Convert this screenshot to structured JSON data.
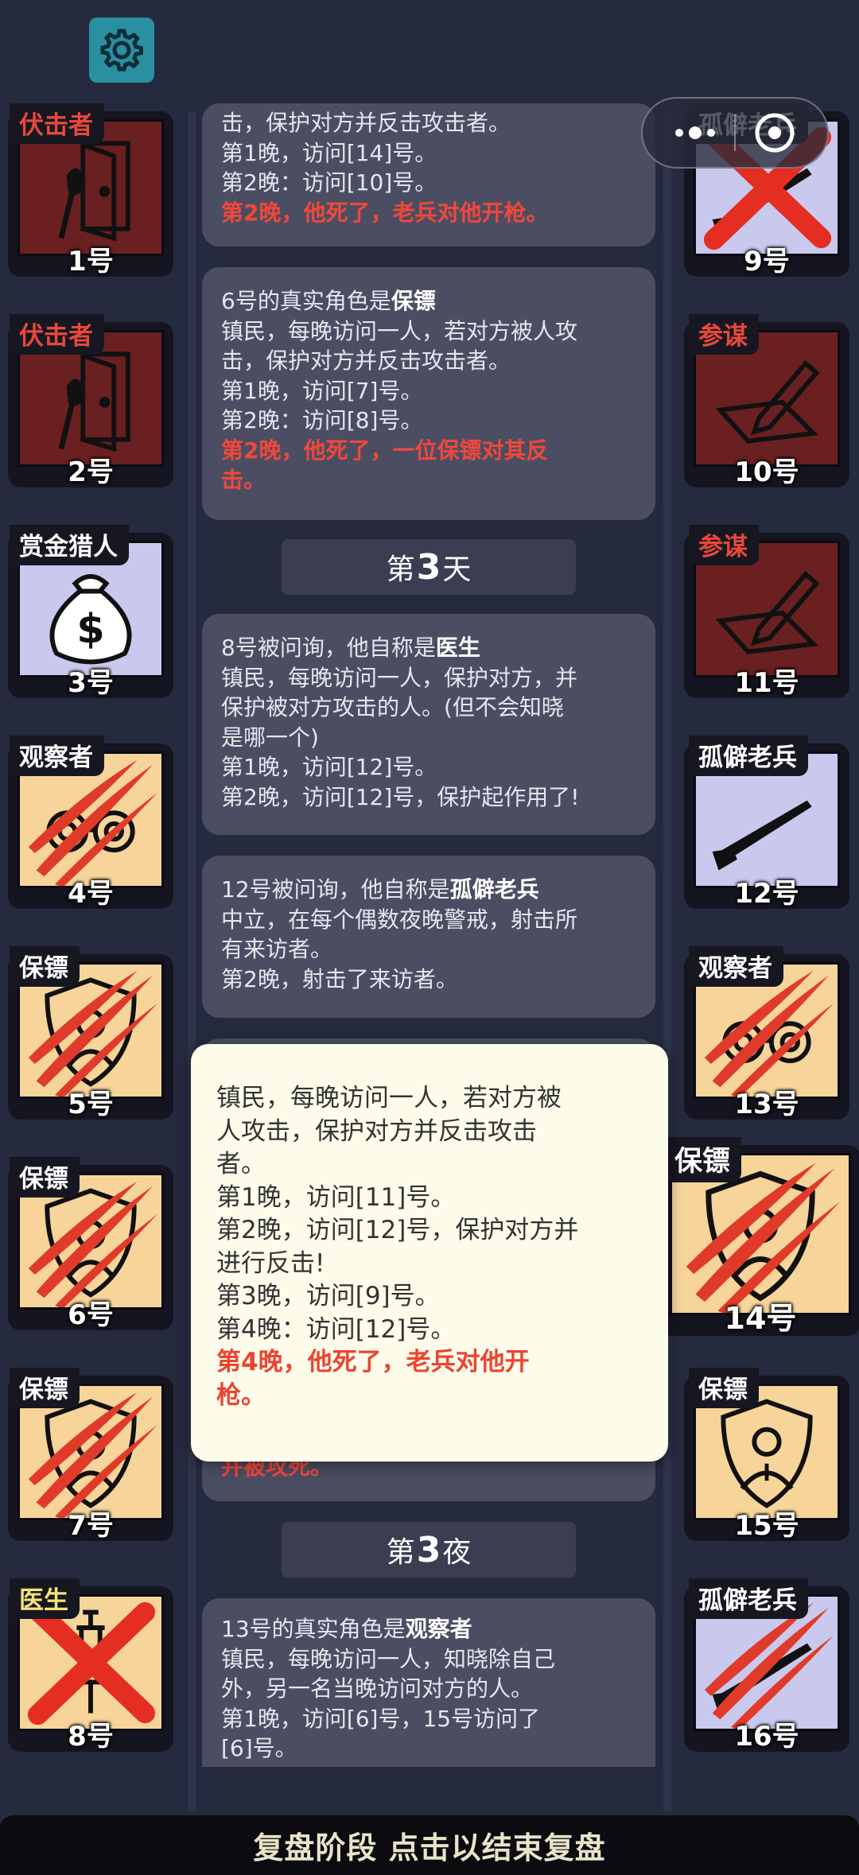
{
  "colors": {
    "background": "#262a3f",
    "log_entry_bg": "#4b4e63",
    "death_text": "#f2473a",
    "role_red": "#e8483a",
    "role_white": "#ffffff",
    "role_gold": "#f6e27a",
    "popup_bg": "#fdfbea",
    "settings_bg": "#2a8fa0"
  },
  "settings": {
    "icon": "gear-icon"
  },
  "mini_program": {
    "more_icon": "more-dots-icon",
    "close_icon": "target-circle-icon"
  },
  "left_players": [
    {
      "role": "伏击者",
      "number": "1号"
    },
    {
      "role": "伏击者",
      "number": "2号"
    },
    {
      "role": "赏金猎人",
      "number": "3号"
    },
    {
      "role": "观察者",
      "number": "4号"
    },
    {
      "role": "保镖",
      "number": "5号"
    },
    {
      "role": "保镖",
      "number": "6号"
    },
    {
      "role": "保镖",
      "number": "7号"
    },
    {
      "role": "医生",
      "number": "8号"
    }
  ],
  "right_players": [
    {
      "role": "孤僻老兵",
      "number": "9号"
    },
    {
      "role": "参谋",
      "number": "10号"
    },
    {
      "role": "参谋",
      "number": "11号"
    },
    {
      "role": "孤僻老兵",
      "number": "12号"
    },
    {
      "role": "观察者",
      "number": "13号"
    },
    {
      "role": "保镖",
      "number": "14号"
    },
    {
      "role": "保镖",
      "number": "15号"
    },
    {
      "role": "孤僻老兵",
      "number": "16号"
    }
  ],
  "log": {
    "entry1": {
      "line1": "击，保护对方并反击攻击者。",
      "line2": "第1晚，访问[14]号。",
      "line3": "第2晚：访问[10]号。",
      "death": "第2晚，他死了，老兵对他开枪。"
    },
    "entry2": {
      "prefix": "6号的真实角色是",
      "role": "保镖",
      "line1": "镇民，每晚访问一人，若对方被人攻",
      "line2": "击，保护对方并反击攻击者。",
      "line3": "第1晚，访问[7]号。",
      "line4": "第2晚：访问[8]号。",
      "death1": "第2晚，他死了，一位保镖对其反",
      "death2": "击。"
    },
    "day3": {
      "prefix": "第",
      "num": "3",
      "suffix": "天"
    },
    "entry3": {
      "prefix": "8号被问询，他自称是",
      "role": "医生",
      "line1": "镇民，每晚访问一人，保护对方，并",
      "line2": "保护被对方攻击的人。(但不会知晓",
      "line3": "是哪一个)",
      "line4": "第1晚，访问[12]号。",
      "line5": "第2晚，访问[12]号，保护起作用了!"
    },
    "entry4": {
      "prefix": "12号被问询，他自称是",
      "role": "孤僻老兵",
      "line1": "中立，在每个偶数夜晚警戒，射击所",
      "line2": "有来访者。",
      "line3": "第2晚，射击了来访者。"
    },
    "entry5": {
      "tail": "并被攻死。"
    },
    "night3": {
      "prefix": "第",
      "num": "3",
      "suffix": "夜"
    },
    "entry6": {
      "prefix": "13号的真实角色是",
      "role": "观察者",
      "line1": "镇民，每晚访问一人，知晓除自己",
      "line2": "外，另一名当晚访问对方的人。",
      "line3": "第1晚，访问[6]号，15号访问了",
      "line4": "[6]号。"
    }
  },
  "popup": {
    "line1": "镇民，每晚访问一人，若对方被",
    "line2": "人攻击，保护对方并反击攻击",
    "line3": "者。",
    "line4": "第1晚，访问[11]号。",
    "line5": "第2晚，访问[12]号，保护对方并",
    "line6": "进行反击!",
    "line7": "第3晚，访问[9]号。",
    "line8": "第4晚：访问[12]号。",
    "death1": "第4晚，他死了，老兵对他开",
    "death2": "枪。"
  },
  "bottom_bar": {
    "label": "复盘阶段 点击以结束复盘"
  }
}
